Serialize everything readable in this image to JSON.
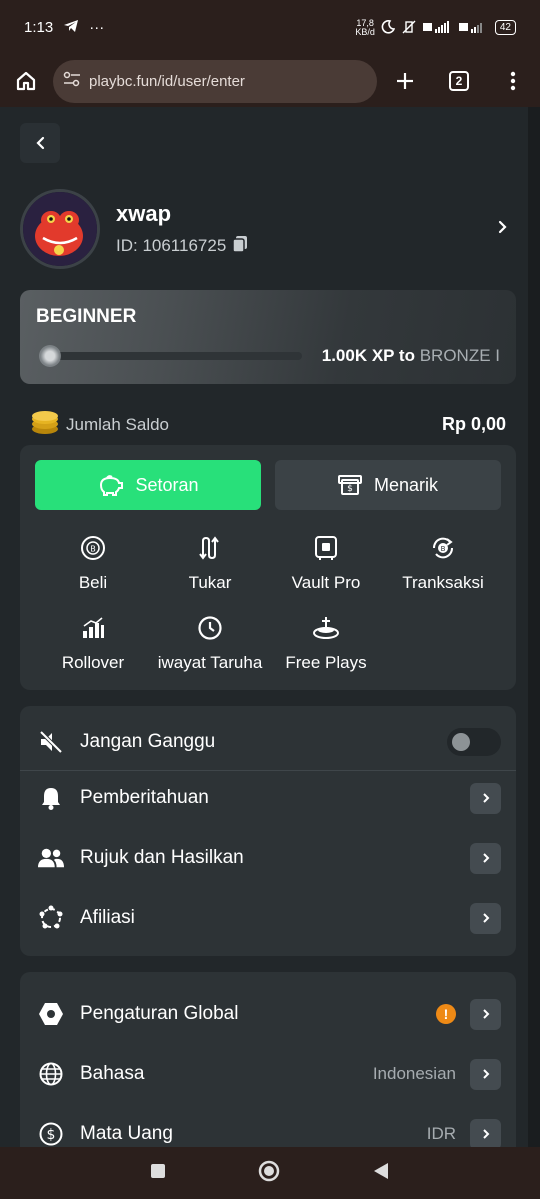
{
  "status_bar": {
    "time": "1:13",
    "network_speed_value": "17,8",
    "network_speed_unit": "KB/d",
    "battery": "42"
  },
  "browser": {
    "url": "playbc.fun/id/user/enter",
    "tab_count": "2"
  },
  "profile": {
    "username": "xwap",
    "user_id": "ID: 106116725"
  },
  "level": {
    "name": "BEGINNER",
    "xp_text": "1.00K XP to",
    "next_level": "BRONZE I",
    "progress_percent": 2
  },
  "balance": {
    "label": "Jumlah Saldo",
    "value": "Rp 0,00"
  },
  "actions": {
    "deposit_label": "Setoran",
    "withdraw_label": "Menarik",
    "grid": [
      {
        "label": "Beli",
        "icon": "bitcoin-coin-icon"
      },
      {
        "label": "Tukar",
        "icon": "swap-arrows-icon"
      },
      {
        "label": "Vault Pro",
        "icon": "vault-icon"
      },
      {
        "label": "Tranksaksi",
        "icon": "transaction-icon"
      },
      {
        "label": "Rollover",
        "icon": "bar-chart-icon"
      },
      {
        "label": "iwayat Taruha",
        "icon": "clock-icon"
      },
      {
        "label": "Free Plays",
        "icon": "free-plays-icon"
      }
    ]
  },
  "settings": {
    "group1": [
      {
        "label": "Jangan Ganggu",
        "icon": "mute-icon"
      },
      {
        "label": "Pemberitahuan",
        "icon": "bell-icon"
      },
      {
        "label": "Rujuk dan Hasilkan",
        "icon": "users-icon"
      },
      {
        "label": "Afiliasi",
        "icon": "affiliate-icon"
      }
    ],
    "group2": [
      {
        "label": "Pengaturan Global",
        "icon": "hex-settings-icon",
        "value": "",
        "warning": "!"
      },
      {
        "label": "Bahasa",
        "icon": "globe-icon",
        "value": "Indonesian"
      },
      {
        "label": "Mata Uang",
        "icon": "dollar-icon",
        "value": "IDR"
      }
    ]
  },
  "colors": {
    "accent_green": "#28e07a",
    "background": "#22272a",
    "card": "#2d3336",
    "warning": "#ee8a16"
  }
}
